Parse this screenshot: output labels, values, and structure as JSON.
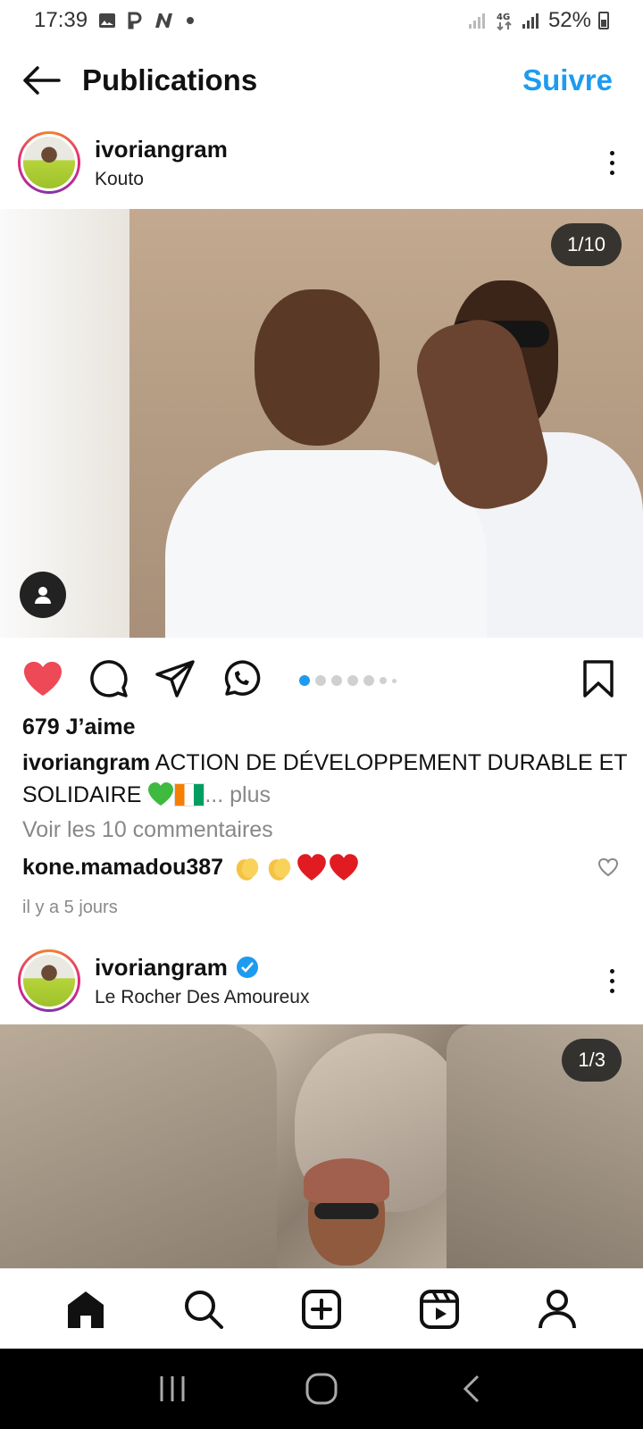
{
  "status_bar": {
    "time": "17:39",
    "left_icons": [
      "image-icon",
      "p-icon",
      "n-icon",
      "dot-icon"
    ],
    "right_icons": [
      "signal-icon",
      "4g-icon",
      "signal-icon"
    ],
    "network": "4G",
    "battery": "52%"
  },
  "header": {
    "back_icon": "arrow-left-icon",
    "title": "Publications",
    "follow_label": "Suivre"
  },
  "post1": {
    "username": "ivoriangram",
    "location": "Kouto",
    "counter": "1/10",
    "likes": "679 J’aime",
    "caption_user": "ivoriangram",
    "caption_text": "ACTION DE DÉVELOPPEMENT DURABLE ET SOLIDAIRE",
    "more_label": "... plus",
    "view_comments": "Voir les 10 commentaires",
    "comment_user": "kone.mamadou387",
    "comment_emojis": [
      "clap",
      "clap",
      "red-heart",
      "red-heart"
    ],
    "time_ago": "il y a 5 jours",
    "liked": true,
    "carousel_total": 10,
    "carousel_index": 1
  },
  "post2": {
    "username": "ivoriangram",
    "verified": true,
    "location": "Le Rocher Des Amoureux",
    "counter": "1/3"
  },
  "bottom_nav": [
    "home-icon",
    "search-icon",
    "create-icon",
    "reels-icon",
    "profile-icon"
  ],
  "colors": {
    "accent": "#1d9bf0",
    "like": "#ed4956",
    "text": "#111111",
    "muted": "#888888"
  }
}
